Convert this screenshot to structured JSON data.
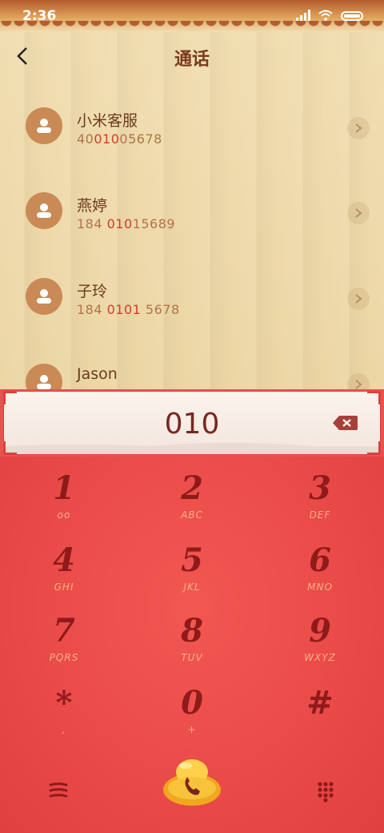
{
  "status_bar": {
    "time": "2:36"
  },
  "header": {
    "title": "通话"
  },
  "contacts": [
    {
      "name": "小米客服",
      "number_parts": [
        "40",
        "010",
        "05678"
      ]
    },
    {
      "name": "燕婷",
      "number_parts": [
        "184 ",
        "010",
        "15689"
      ]
    },
    {
      "name": "子玲",
      "number_parts": [
        "184 ",
        "0101",
        " 5678"
      ]
    },
    {
      "name": "Jason",
      "number_parts": [
        "",
        "",
        ""
      ]
    }
  ],
  "dial_input": {
    "value": "010"
  },
  "keypad": [
    {
      "digit": "1",
      "letters": "oo"
    },
    {
      "digit": "2",
      "letters": "ABC"
    },
    {
      "digit": "3",
      "letters": "DEF"
    },
    {
      "digit": "4",
      "letters": "GHI"
    },
    {
      "digit": "5",
      "letters": "JKL"
    },
    {
      "digit": "6",
      "letters": "MNO"
    },
    {
      "digit": "7",
      "letters": "PQRS"
    },
    {
      "digit": "8",
      "letters": "TUV"
    },
    {
      "digit": "9",
      "letters": "WXYZ"
    },
    {
      "digit": "*",
      "letters": ","
    },
    {
      "digit": "0",
      "letters": "+"
    },
    {
      "digit": "#",
      "letters": ""
    }
  ],
  "colors": {
    "accent_red": "#e8534f",
    "highlight_match": "#d53a2a",
    "brown_text": "#6b3a1f"
  },
  "icons": {
    "back": "back-arrow-icon",
    "contact": "person-avatar-icon",
    "detail": "chevron-right-icon",
    "delete": "backspace-icon",
    "menu": "menu-icon",
    "call": "phone-icon",
    "dialpad": "dialpad-grid-icon"
  }
}
